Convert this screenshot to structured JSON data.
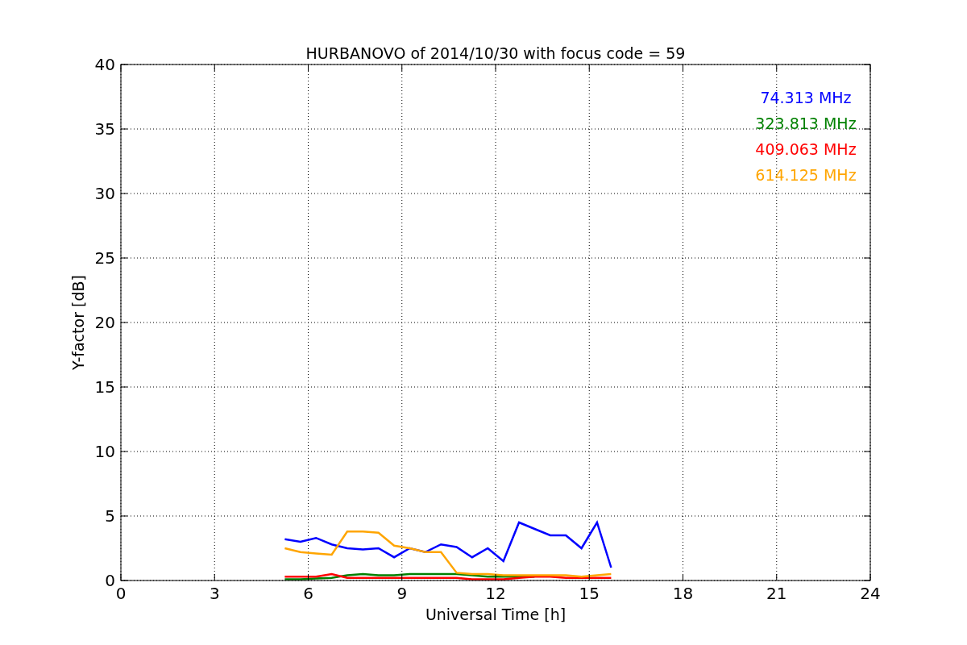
{
  "chart_data": {
    "type": "line",
    "title": "HURBANOVO of 2014/10/30 with focus code = 59",
    "xlabel": "Universal Time [h]",
    "ylabel": "Y-factor [dB]",
    "x": [
      5.25,
      5.75,
      6.25,
      6.75,
      7.25,
      7.75,
      8.25,
      8.75,
      9.25,
      9.75,
      10.25,
      10.75,
      11.25,
      11.75,
      12.25,
      12.75,
      13.25,
      13.75,
      14.25,
      14.75,
      15.25,
      15.7
    ],
    "series": [
      {
        "name": "74.313 MHz",
        "color": "#0000ff",
        "values": [
          3.2,
          3.0,
          3.3,
          2.8,
          2.5,
          2.4,
          2.5,
          1.8,
          2.5,
          2.2,
          2.8,
          2.6,
          1.8,
          2.5,
          1.5,
          4.5,
          4.0,
          3.5,
          3.5,
          2.5,
          4.5,
          1.0
        ]
      },
      {
        "name": "323.813 MHz",
        "color": "#008000",
        "values": [
          0.1,
          0.1,
          0.15,
          0.2,
          0.4,
          0.5,
          0.4,
          0.4,
          0.5,
          0.5,
          0.5,
          0.5,
          0.4,
          0.3,
          0.3,
          0.3,
          0.3,
          null,
          null,
          null,
          null,
          null
        ]
      },
      {
        "name": "409.063 MHz",
        "color": "#ff0000",
        "values": [
          0.3,
          0.3,
          0.3,
          0.5,
          0.2,
          0.2,
          0.2,
          0.2,
          0.2,
          0.2,
          0.2,
          0.2,
          0.1,
          0.1,
          0.1,
          0.2,
          0.3,
          0.3,
          0.2,
          0.2,
          0.2,
          0.2
        ]
      },
      {
        "name": "614.125 MHz",
        "color": "#ffa500",
        "values": [
          2.5,
          2.2,
          2.1,
          2.0,
          3.8,
          3.8,
          3.7,
          2.7,
          2.5,
          2.2,
          2.2,
          0.6,
          0.5,
          0.5,
          0.4,
          0.4,
          0.4,
          0.4,
          0.4,
          0.3,
          0.4,
          0.5
        ]
      }
    ],
    "grid": true,
    "xlim": [
      0,
      24
    ],
    "ylim": [
      0,
      40
    ],
    "xticks": [
      0,
      3,
      6,
      9,
      12,
      15,
      18,
      21,
      24
    ],
    "yticks": [
      0,
      5,
      10,
      15,
      20,
      25,
      30,
      35,
      40
    ]
  }
}
